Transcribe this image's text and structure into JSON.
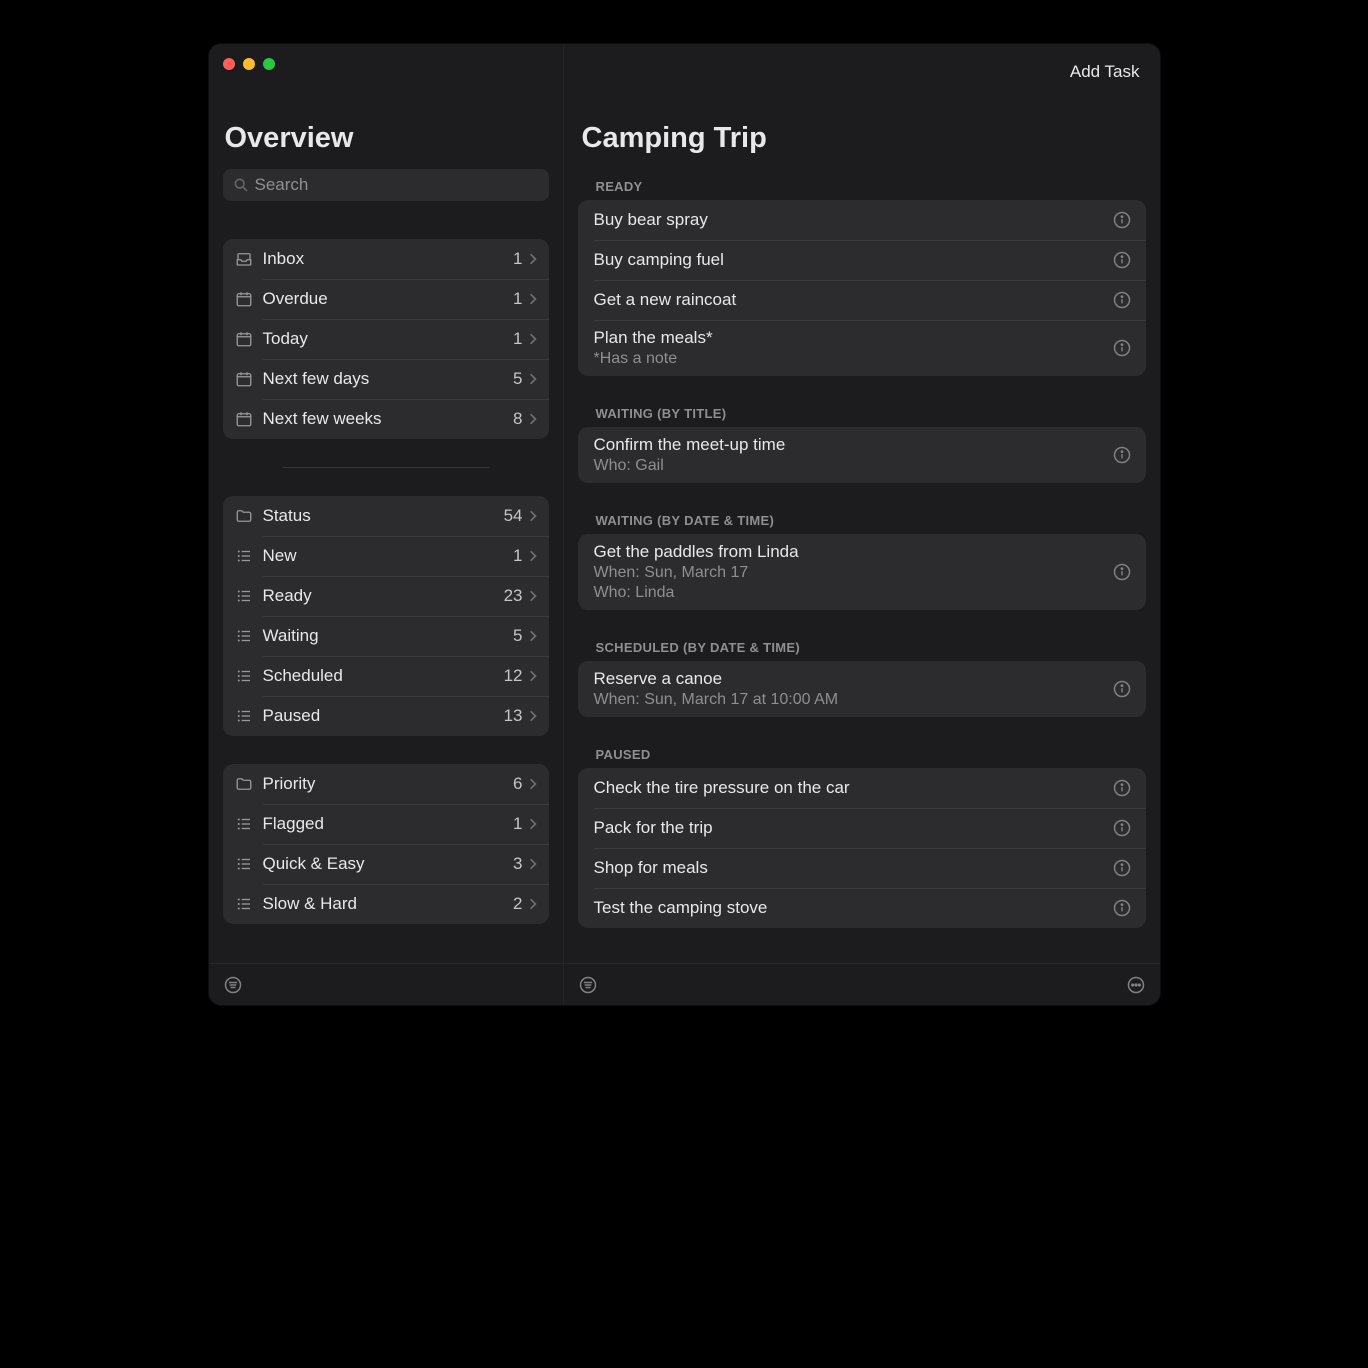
{
  "sidebar": {
    "title": "Overview",
    "searchPlaceholder": "Search",
    "groups": [
      {
        "name": "schedule",
        "items": [
          {
            "icon": "tray",
            "label": "Inbox",
            "count": "1"
          },
          {
            "icon": "calendar",
            "label": "Overdue",
            "count": "1"
          },
          {
            "icon": "calendar",
            "label": "Today",
            "count": "1"
          },
          {
            "icon": "calendar",
            "label": "Next few days",
            "count": "5"
          },
          {
            "icon": "calendar",
            "label": "Next few weeks",
            "count": "8"
          }
        ]
      },
      {
        "name": "status",
        "items": [
          {
            "icon": "folder",
            "label": "Status",
            "count": "54"
          },
          {
            "icon": "list",
            "label": "New",
            "count": "1"
          },
          {
            "icon": "list",
            "label": "Ready",
            "count": "23"
          },
          {
            "icon": "list",
            "label": "Waiting",
            "count": "5"
          },
          {
            "icon": "list",
            "label": "Scheduled",
            "count": "12"
          },
          {
            "icon": "list",
            "label": "Paused",
            "count": "13"
          }
        ]
      },
      {
        "name": "priority",
        "items": [
          {
            "icon": "folder",
            "label": "Priority",
            "count": "6"
          },
          {
            "icon": "list",
            "label": "Flagged",
            "count": "1"
          },
          {
            "icon": "list",
            "label": "Quick & Easy",
            "count": "3"
          },
          {
            "icon": "list",
            "label": "Slow & Hard",
            "count": "2"
          }
        ]
      }
    ]
  },
  "main": {
    "addTaskLabel": "Add Task",
    "title": "Camping Trip",
    "sections": [
      {
        "header": "READY",
        "tasks": [
          {
            "title": "Buy bear spray"
          },
          {
            "title": "Buy camping fuel"
          },
          {
            "title": "Get a new raincoat"
          },
          {
            "title": "Plan the meals*",
            "sub": "*Has a note"
          }
        ]
      },
      {
        "header": "WAITING (BY TITLE)",
        "tasks": [
          {
            "title": "Confirm the meet-up time",
            "sub": "Who: Gail"
          }
        ]
      },
      {
        "header": "WAITING (BY DATE & TIME)",
        "tasks": [
          {
            "title": "Get the paddles from Linda",
            "sub": "When: Sun, March 17",
            "sub2": "Who: Linda"
          }
        ]
      },
      {
        "header": "SCHEDULED (BY DATE & TIME)",
        "tasks": [
          {
            "title": "Reserve a canoe",
            "sub": "When: Sun, March 17 at 10:00 AM"
          }
        ]
      },
      {
        "header": "PAUSED",
        "tasks": [
          {
            "title": "Check the tire pressure on the car"
          },
          {
            "title": "Pack for the trip"
          },
          {
            "title": "Shop for meals"
          },
          {
            "title": "Test the camping stove"
          }
        ]
      }
    ]
  }
}
